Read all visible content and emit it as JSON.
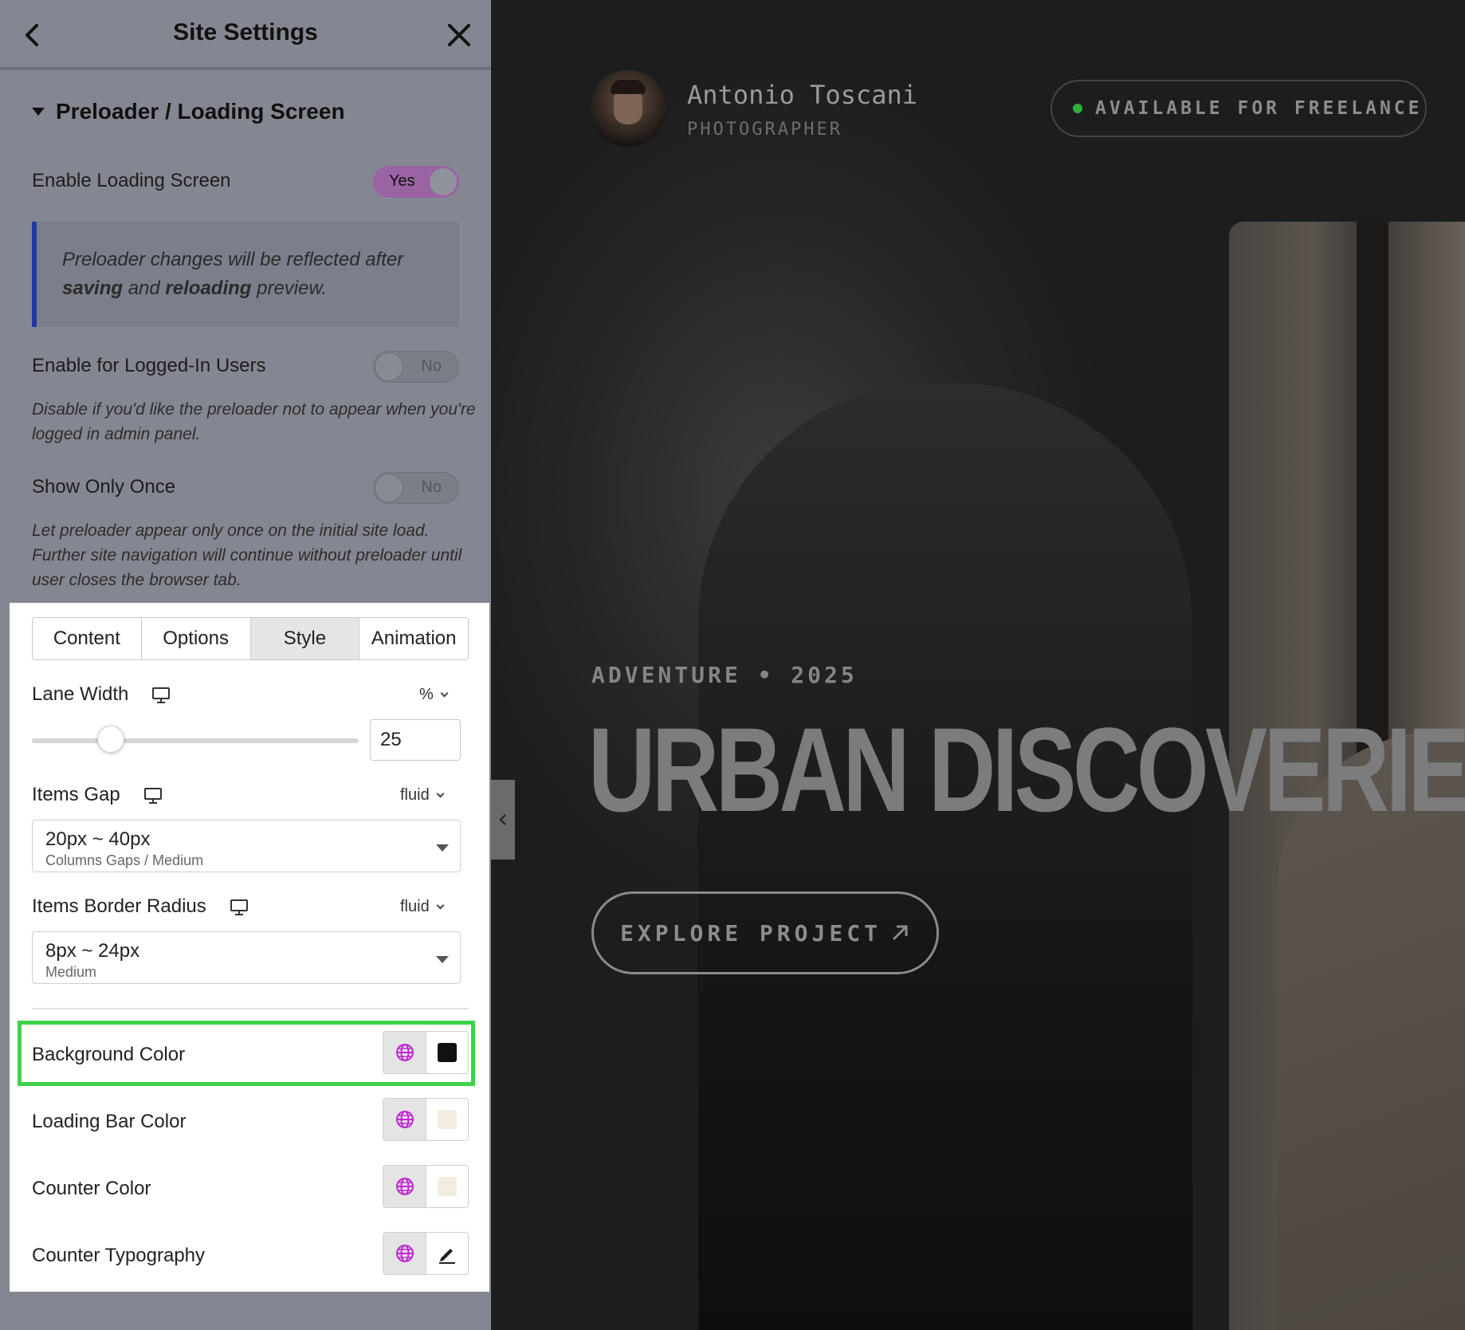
{
  "panel": {
    "title": "Site Settings",
    "section_title": "Preloader / Loading Screen",
    "enable_loading": {
      "label": "Enable Loading Screen",
      "state": "Yes"
    },
    "notice": {
      "pre": "Preloader changes will be reflected after ",
      "b1": "saving",
      "mid": " and ",
      "b2": "reloading",
      "post": " preview."
    },
    "logged_in": {
      "label": "Enable for Logged-In Users",
      "state": "No",
      "help": "Disable if you'd like the preloader not to appear when you're logged in admin panel."
    },
    "show_once": {
      "label": "Show Only Once",
      "state": "No",
      "help": "Let preloader appear only once on the initial site load. Further site navigation will continue without preloader until user closes the browser tab."
    }
  },
  "tabs": [
    "Content",
    "Options",
    "Style",
    "Animation"
  ],
  "active_tab": "Style",
  "style": {
    "lane_width": {
      "label": "Lane Width",
      "unit": "%",
      "value": "25",
      "fraction": 0.25
    },
    "items_gap": {
      "label": "Items Gap",
      "unit": "fluid",
      "value": "20px ~ 40px",
      "sub": "Columns Gaps / Medium"
    },
    "items_radius": {
      "label": "Items Border Radius",
      "unit": "fluid",
      "value": "8px ~ 24px",
      "sub": "Medium"
    },
    "bg_color": {
      "label": "Background Color",
      "color": "#111111"
    },
    "bar_color": {
      "label": "Loading Bar Color",
      "color": "#f3ede1"
    },
    "counter_color": {
      "label": "Counter Color",
      "color": "#f3ede1"
    },
    "counter_typo": {
      "label": "Counter Typography"
    }
  },
  "icons": [
    "back-arrow-icon",
    "close-icon",
    "caret-down-icon",
    "monitor-icon",
    "chevron-down-icon",
    "globe-icon",
    "pencil-icon",
    "arrow-up-right-icon",
    "chevron-left-icon"
  ],
  "colors": {
    "accent": "#9a63a3",
    "globe": "#c026d3",
    "highlight": "#3dd34a",
    "notice_border": "#1e3aa0",
    "available_dot": "#2fae3c"
  },
  "preview": {
    "name": "Antonio Toscani",
    "role": "PHOTOGRAPHER",
    "available": "AVAILABLE FOR FREELANCE",
    "eyebrow": "ADVENTURE • 2025",
    "headline": "URBAN DISCOVERIES",
    "cta": "EXPLORE PROJECT"
  }
}
